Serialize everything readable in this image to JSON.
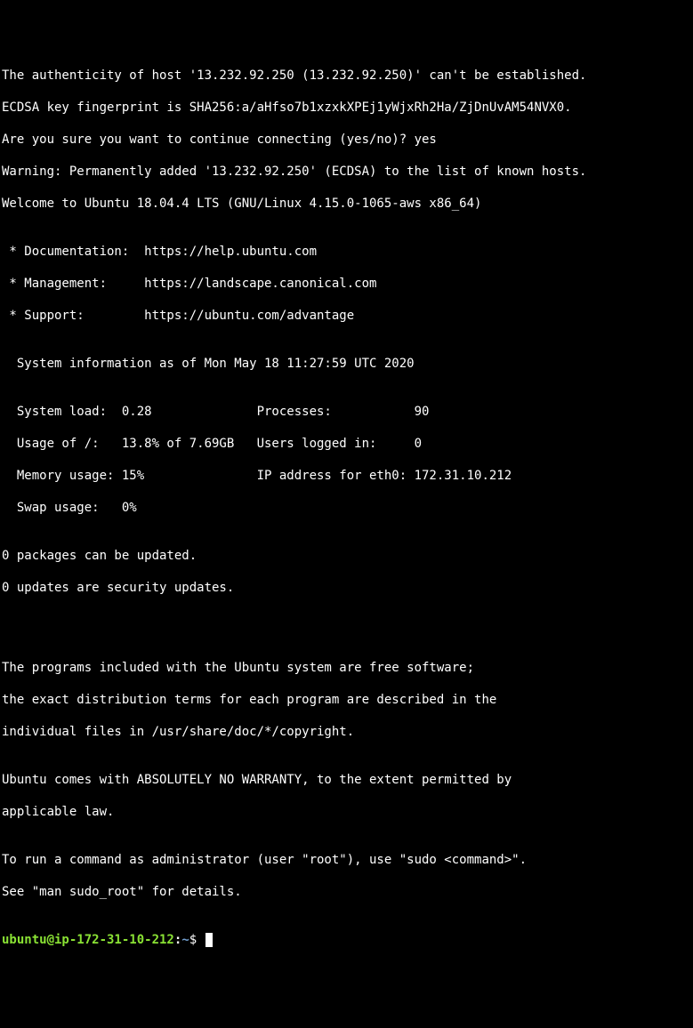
{
  "lines": {
    "l0": "The authenticity of host '13.232.92.250 (13.232.92.250)' can't be established.",
    "l1": "ECDSA key fingerprint is SHA256:a/aHfso7b1xzxkXPEj1yWjxRh2Ha/ZjDnUvAM54NVX0.",
    "l2": "Are you sure you want to continue connecting (yes/no)? yes",
    "l3": "Warning: Permanently added '13.232.92.250' (ECDSA) to the list of known hosts.",
    "l4": "Welcome to Ubuntu 18.04.4 LTS (GNU/Linux 4.15.0-1065-aws x86_64)",
    "l5": "",
    "l6": " * Documentation:  https://help.ubuntu.com",
    "l7": " * Management:     https://landscape.canonical.com",
    "l8": " * Support:        https://ubuntu.com/advantage",
    "l9": "",
    "l10": "  System information as of Mon May 18 11:27:59 UTC 2020",
    "l11": "",
    "l12": "  System load:  0.28              Processes:           90",
    "l13": "  Usage of /:   13.8% of 7.69GB   Users logged in:     0",
    "l14": "  Memory usage: 15%               IP address for eth0: 172.31.10.212",
    "l15": "  Swap usage:   0%",
    "l16": "",
    "l17": "0 packages can be updated.",
    "l18": "0 updates are security updates.",
    "l19": "",
    "l20": "",
    "l21": "",
    "l22": "The programs included with the Ubuntu system are free software;",
    "l23": "the exact distribution terms for each program are described in the",
    "l24": "individual files in /usr/share/doc/*/copyright.",
    "l25": "",
    "l26": "Ubuntu comes with ABSOLUTELY NO WARRANTY, to the extent permitted by",
    "l27": "applicable law.",
    "l28": "",
    "l29": "To run a command as administrator (user \"root\"), use \"sudo <command>\".",
    "l30": "See \"man sudo_root\" for details.",
    "l31": ""
  },
  "prompt": {
    "user_host": "ubuntu@ip-172-31-10-212",
    "sep": ":",
    "path": "~",
    "end": "$ "
  }
}
